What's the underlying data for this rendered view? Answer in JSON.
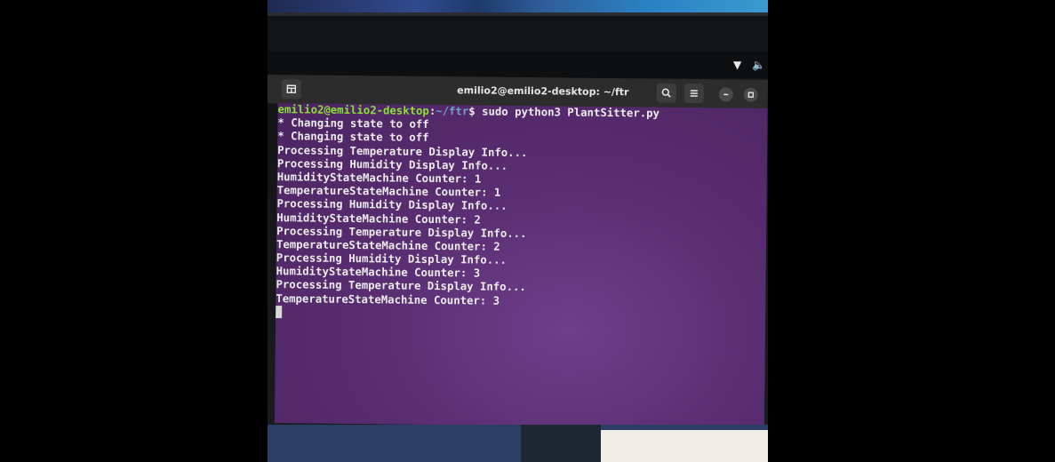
{
  "window": {
    "title": "emilio2@emilio2-desktop: ~/ftr"
  },
  "icons": {
    "newtab": "new-tab-icon",
    "search": "search-icon",
    "menu": "hamburger-menu-icon",
    "minimize": "minimize-icon",
    "maximize": "maximize-icon",
    "wifi": "wifi-icon",
    "volume": "volume-icon"
  },
  "terminal": {
    "prompt": {
      "user_host": "emilio2@emilio2-desktop",
      "colon": ":",
      "path": "~/ftr",
      "dollar": "$ ",
      "command": "sudo python3 PlantSitter.py"
    },
    "output": [
      "* Changing state to off",
      "* Changing state to off",
      "Processing Temperature Display Info...",
      "Processing Humidity Display Info...",
      "HumidityStateMachine Counter: 1",
      "TemperatureStateMachine Counter: 1",
      "Processing Humidity Display Info...",
      "HumidityStateMachine Counter: 2",
      "Processing Temperature Display Info...",
      "TemperatureStateMachine Counter: 2",
      "Processing Humidity Display Info...",
      "HumidityStateMachine Counter: 3",
      "Processing Temperature Display Info...",
      "TemperatureStateMachine Counter: 3"
    ]
  },
  "colors": {
    "terminal_bg": "#5a2e72",
    "prompt_user": "#8ae234",
    "prompt_path": "#729fcf",
    "titlebar": "#2c2c2c"
  }
}
